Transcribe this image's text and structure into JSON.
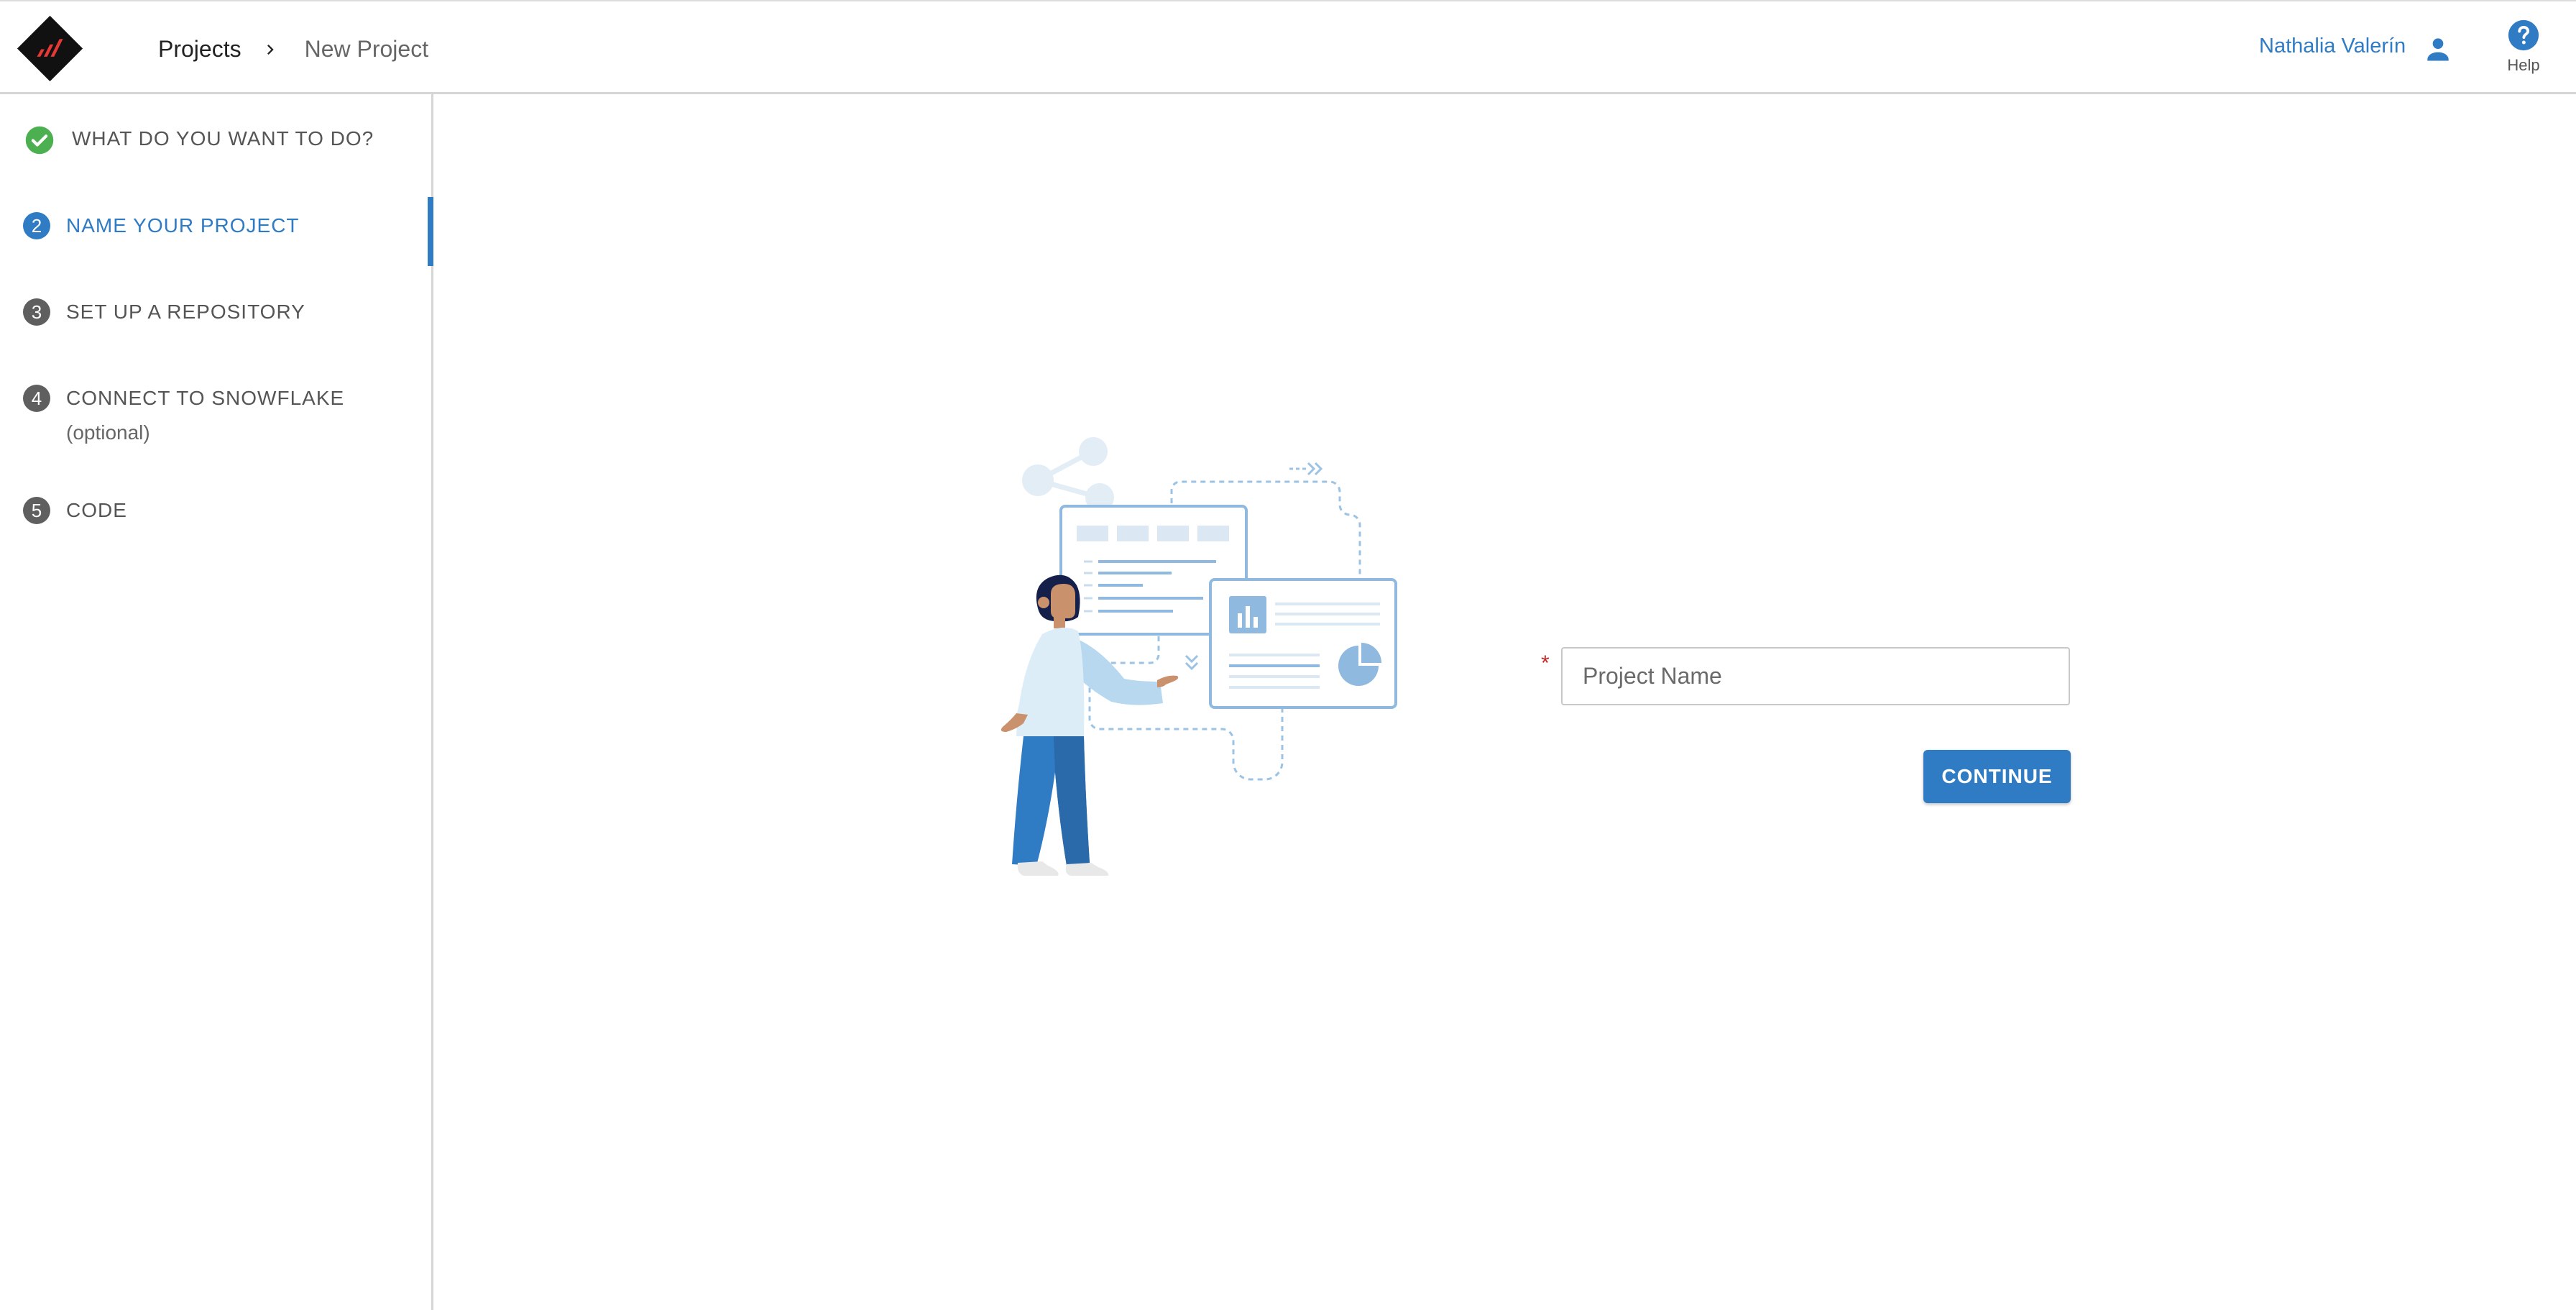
{
  "header": {
    "breadcrumb": {
      "root": "Projects",
      "current": "New Project"
    },
    "user_name": "Nathalia Valerín",
    "help_label": "Help"
  },
  "sidebar": {
    "steps": [
      {
        "number": "",
        "label": "WHAT DO YOU WANT TO DO?",
        "status": "complete"
      },
      {
        "number": "2",
        "label": "NAME YOUR PROJECT",
        "status": "active"
      },
      {
        "number": "3",
        "label": "SET UP A REPOSITORY",
        "status": "pending"
      },
      {
        "number": "4",
        "label": "CONNECT TO SNOWFLAKE",
        "sublabel": "(optional)",
        "status": "pending"
      },
      {
        "number": "5",
        "label": "CODE",
        "status": "pending"
      }
    ]
  },
  "form": {
    "project_name_placeholder": "Project Name",
    "project_name_value": "",
    "continue_label": "CONTINUE"
  },
  "colors": {
    "accent": "#2f7bc4",
    "complete": "#4caf50",
    "required": "#c62828"
  },
  "icons": {
    "logo": "logo-icon",
    "breadcrumb_separator": "chevron-right-icon",
    "user": "person-icon",
    "help": "help-circle-icon",
    "complete_step": "check-circle-icon"
  }
}
